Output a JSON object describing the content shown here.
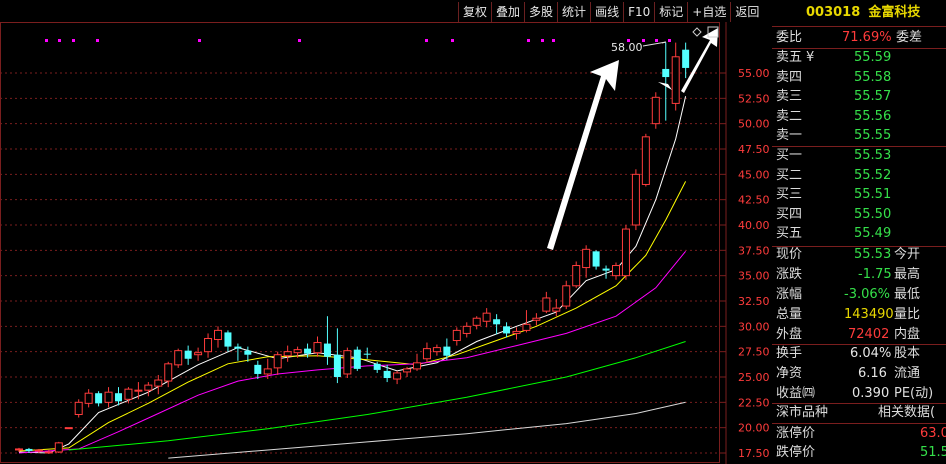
{
  "toolbar": [
    "复权",
    "叠加",
    "多股",
    "统计",
    "画线",
    "F10",
    "标记",
    "+自选",
    "返回"
  ],
  "stock": {
    "code": "003018",
    "name": "金富科技"
  },
  "weibi": {
    "label": "委比",
    "value": "71.69%",
    "label2": "委差"
  },
  "sell": [
    {
      "label": "卖五",
      "mark": "¥",
      "price": "55.59"
    },
    {
      "label": "卖四",
      "mark": "",
      "price": "55.58"
    },
    {
      "label": "卖三",
      "mark": "",
      "price": "55.57"
    },
    {
      "label": "卖二",
      "mark": "",
      "price": "55.56"
    },
    {
      "label": "卖一",
      "mark": "",
      "price": "55.55"
    }
  ],
  "buy": [
    {
      "label": "买一",
      "price": "55.53"
    },
    {
      "label": "买二",
      "price": "55.52"
    },
    {
      "label": "买三",
      "price": "55.51"
    },
    {
      "label": "买四",
      "price": "55.50"
    },
    {
      "label": "买五",
      "price": "55.49"
    }
  ],
  "quote": {
    "xianjia_label": "现价",
    "xianjia": "55.53",
    "jinkai_label": "今开",
    "zhangdie_label": "涨跌",
    "zhangdie": "-1.75",
    "zuigao_label": "最高",
    "zhangfu_label": "涨幅",
    "zhangfu": "-3.06%",
    "zuidi_label": "最低",
    "zongliang_label": "总量",
    "zongliang": "143490",
    "liangbi_label": "量比",
    "waipan_label": "外盘",
    "waipan": "72402",
    "neipan_label": "内盘",
    "huanshou_label": "换手",
    "huanshou": "6.04%",
    "guben_label": "股本",
    "jingzi_label": "净资",
    "jingzi": "6.16",
    "liutong_label": "流通",
    "shouyi_label": "收益㈣",
    "shouyi": "0.390",
    "pe_label": "PE(动)"
  },
  "market": {
    "label": "深市品种",
    "related": "相关数据(",
    "zhangting_label": "涨停价",
    "zhangting": "63.0",
    "dieting_label": "跌停价",
    "dieting": "51.5"
  },
  "marker_text": "58.00",
  "colors": {
    "up": "#ff3c3c",
    "down": "#54ffff",
    "ma5": "#ffffff",
    "ma10": "#ffff00",
    "ma20": "#ff00ff",
    "ma60": "#00ff00",
    "ma120": "#d8d8d8",
    "grid": "#7a1e1e"
  },
  "chart_data": {
    "type": "candlestick",
    "ylim": [
      17.5,
      57.5
    ],
    "yticks": [
      "55.00",
      "52.50",
      "50.00",
      "47.50",
      "45.00",
      "42.50",
      "40.00",
      "37.50",
      "35.00",
      "32.50",
      "30.00",
      "27.50",
      "25.00",
      "22.50",
      "20.00",
      "17.50"
    ],
    "candles": [
      [
        17.8,
        17.9,
        17.6,
        18.0
      ],
      [
        17.9,
        17.7,
        17.5,
        18.0
      ],
      [
        17.7,
        17.8,
        17.5,
        17.9
      ],
      [
        17.6,
        17.6,
        17.4,
        17.8
      ],
      [
        17.6,
        18.5,
        17.5,
        18.6
      ],
      [
        20.0,
        20.0,
        20.0,
        20.0
      ],
      [
        21.3,
        22.5,
        21.0,
        22.8
      ],
      [
        22.4,
        23.4,
        22.0,
        23.8
      ],
      [
        23.4,
        22.4,
        22.1,
        23.6
      ],
      [
        22.5,
        23.5,
        22.0,
        24.0
      ],
      [
        23.4,
        22.6,
        22.2,
        24.0
      ],
      [
        22.8,
        23.8,
        22.4,
        24.0
      ],
      [
        23.6,
        23.7,
        22.8,
        24.5
      ],
      [
        23.7,
        24.2,
        23.1,
        24.5
      ],
      [
        24.1,
        24.7,
        23.3,
        25.2
      ],
      [
        24.6,
        26.3,
        24.0,
        26.5
      ],
      [
        26.2,
        27.6,
        25.9,
        27.8
      ],
      [
        27.6,
        26.8,
        26.2,
        28.1
      ],
      [
        27.2,
        27.4,
        26.6,
        27.9
      ],
      [
        27.5,
        28.8,
        26.9,
        29.3
      ],
      [
        28.7,
        29.6,
        27.9,
        30.0
      ],
      [
        29.4,
        28.0,
        27.5,
        29.6
      ],
      [
        28.0,
        27.8,
        26.6,
        28.3
      ],
      [
        27.6,
        27.2,
        26.5,
        28.0
      ],
      [
        26.2,
        25.3,
        24.8,
        26.6
      ],
      [
        25.3,
        25.8,
        24.8,
        26.8
      ],
      [
        25.9,
        27.2,
        25.2,
        27.5
      ],
      [
        27.1,
        27.5,
        26.5,
        28.1
      ],
      [
        27.4,
        27.7,
        26.9,
        28.0
      ],
      [
        27.8,
        27.3,
        26.9,
        28.3
      ],
      [
        27.4,
        28.4,
        27.0,
        29.0
      ],
      [
        28.3,
        27.0,
        26.2,
        31.0
      ],
      [
        27.2,
        25.0,
        24.4,
        29.8
      ],
      [
        25.3,
        27.6,
        24.9,
        27.9
      ],
      [
        27.7,
        25.8,
        25.6,
        28.0
      ],
      [
        27.3,
        27.2,
        26.8,
        27.9
      ],
      [
        26.3,
        25.7,
        25.4,
        26.5
      ],
      [
        25.6,
        24.9,
        24.5,
        26.2
      ],
      [
        24.8,
        25.4,
        24.3,
        25.6
      ],
      [
        25.5,
        25.8,
        25.0,
        26.0
      ],
      [
        25.8,
        26.4,
        25.6,
        27.3
      ],
      [
        26.8,
        27.8,
        26.4,
        28.4
      ],
      [
        27.5,
        27.9,
        27.1,
        28.2
      ],
      [
        28.0,
        27.1,
        26.7,
        28.8
      ],
      [
        28.6,
        29.6,
        28.1,
        29.9
      ],
      [
        29.3,
        30.0,
        28.9,
        30.4
      ],
      [
        30.1,
        30.8,
        29.7,
        31.0
      ],
      [
        30.5,
        31.3,
        29.9,
        31.8
      ],
      [
        30.7,
        30.2,
        29.2,
        31.2
      ],
      [
        30.0,
        29.3,
        28.9,
        30.4
      ],
      [
        29.3,
        29.5,
        28.7,
        29.9
      ],
      [
        29.6,
        30.2,
        29.4,
        31.6
      ],
      [
        30.6,
        30.8,
        30.1,
        31.3
      ],
      [
        31.5,
        32.8,
        31.3,
        33.4
      ],
      [
        31.5,
        31.8,
        31.0,
        32.7
      ],
      [
        32.0,
        34.0,
        31.7,
        34.5
      ],
      [
        34.0,
        36.0,
        33.8,
        36.4
      ],
      [
        35.8,
        37.6,
        34.8,
        38.0
      ],
      [
        37.4,
        35.9,
        35.6,
        37.5
      ],
      [
        35.7,
        35.5,
        34.7,
        36.0
      ],
      [
        35.0,
        36.0,
        34.6,
        36.3
      ],
      [
        35.0,
        39.6,
        34.6,
        40.0
      ],
      [
        40.0,
        45.0,
        39.5,
        45.5
      ],
      [
        44.0,
        48.7,
        43.8,
        49.0
      ],
      [
        50.0,
        52.6,
        49.5,
        53.1
      ],
      [
        55.4,
        54.6,
        50.3,
        58.0
      ],
      [
        52.0,
        56.6,
        51.3,
        58.0
      ],
      [
        57.3,
        55.5,
        54.5,
        58.0
      ]
    ],
    "ma": [
      {
        "key": "ma5",
        "values": [
          [
            0,
            17.6
          ],
          [
            3,
            17.5
          ],
          [
            5,
            18.4
          ],
          [
            8,
            21.5
          ],
          [
            13,
            23.5
          ],
          [
            18,
            26.2
          ],
          [
            22,
            27.9
          ],
          [
            26,
            26.8
          ],
          [
            30,
            27.4
          ],
          [
            34,
            26.9
          ],
          [
            38,
            25.6
          ],
          [
            42,
            26.4
          ],
          [
            46,
            28.5
          ],
          [
            50,
            30.0
          ],
          [
            54,
            31.4
          ],
          [
            57,
            34.5
          ],
          [
            60,
            35.6
          ],
          [
            62,
            37.9
          ],
          [
            64,
            42.5
          ],
          [
            66,
            48.5
          ],
          [
            67,
            52.7
          ]
        ]
      },
      {
        "key": "ma10",
        "values": [
          [
            0,
            17.7
          ],
          [
            5,
            18.0
          ],
          [
            9,
            20.5
          ],
          [
            13,
            22.4
          ],
          [
            17,
            24.5
          ],
          [
            21,
            26.3
          ],
          [
            25,
            27.0
          ],
          [
            30,
            27.1
          ],
          [
            35,
            26.7
          ],
          [
            40,
            26.2
          ],
          [
            44,
            27.2
          ],
          [
            48,
            28.6
          ],
          [
            52,
            30.0
          ],
          [
            56,
            31.8
          ],
          [
            60,
            34.0
          ],
          [
            63,
            37.0
          ],
          [
            65,
            40.5
          ],
          [
            67,
            44.3
          ]
        ]
      },
      {
        "key": "ma20",
        "values": [
          [
            0,
            17.5
          ],
          [
            6,
            17.9
          ],
          [
            10,
            19.6
          ],
          [
            14,
            21.4
          ],
          [
            18,
            23.2
          ],
          [
            22,
            24.6
          ],
          [
            26,
            25.3
          ],
          [
            30,
            25.7
          ],
          [
            35,
            26.1
          ],
          [
            40,
            26.3
          ],
          [
            45,
            26.9
          ],
          [
            50,
            28.1
          ],
          [
            55,
            29.3
          ],
          [
            60,
            31.0
          ],
          [
            64,
            33.8
          ],
          [
            67,
            37.4
          ]
        ]
      },
      {
        "key": "ma60",
        "values": [
          [
            5,
            17.8
          ],
          [
            15,
            18.7
          ],
          [
            25,
            19.9
          ],
          [
            35,
            21.3
          ],
          [
            45,
            23.0
          ],
          [
            55,
            25.0
          ],
          [
            62,
            26.9
          ],
          [
            67,
            28.5
          ]
        ]
      },
      {
        "key": "ma120",
        "values": [
          [
            15,
            17.0
          ],
          [
            25,
            17.8
          ],
          [
            35,
            18.6
          ],
          [
            45,
            19.4
          ],
          [
            55,
            20.4
          ],
          [
            62,
            21.4
          ],
          [
            67,
            22.5
          ]
        ]
      }
    ]
  }
}
